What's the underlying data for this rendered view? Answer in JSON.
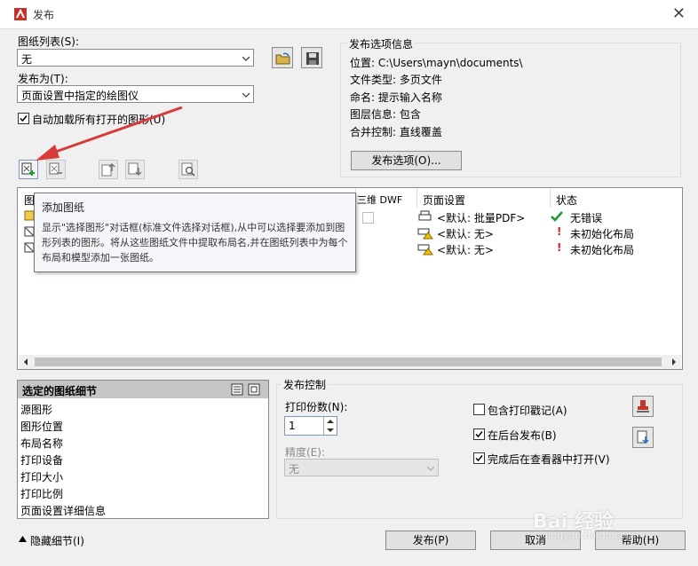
{
  "window": {
    "title": "发布",
    "close": "✕"
  },
  "sheet_list": {
    "label": "图纸列表(S):",
    "value": "无"
  },
  "publish_to": {
    "label": "发布为(T):",
    "value": "页面设置中指定的绘图仪"
  },
  "auto_load": {
    "label": "自动加载所有打开的图形(U)",
    "checked": true
  },
  "options_info": {
    "title": "发布选项信息",
    "rows": [
      "位置: C:\\Users\\mayn\\documents\\",
      "文件类型: 多页文件",
      "命名: 提示输入名称",
      "图层信息: 包含",
      "合并控制: 直线覆盖"
    ],
    "button": "发布选项(O)..."
  },
  "list": {
    "headers": [
      "图",
      "三维 DWF",
      "页面设置",
      "状态"
    ],
    "rows": [
      {
        "page_setup": "<默认: 批量PDF>",
        "status": "无错误",
        "status_icon": "green-check"
      },
      {
        "page_setup": "<默认: 无>",
        "status": "未初始化布局",
        "status_icon": "red-exclamation"
      },
      {
        "page_setup": "<默认: 无>",
        "status": "未初始化布局",
        "status_icon": "red-exclamation"
      }
    ]
  },
  "tooltip": {
    "title": "添加图纸",
    "body": "显示\"选择图形\"对话框(标准文件选择对话框),从中可以选择要添加到图形列表的图形。将从这些图纸文件中提取布局名,并在图纸列表中为每个布局和模型添加一张图纸。"
  },
  "details": {
    "title": "选定的图纸细节",
    "items": [
      "源图形",
      "图形位置",
      "布局名称",
      "打印设备",
      "打印大小",
      "打印比例",
      "页面设置详细信息"
    ]
  },
  "publish_control": {
    "title": "发布控制",
    "copies_label": "打印份数(N):",
    "copies_value": "1",
    "precision_label": "精度(E):",
    "precision_value": "无",
    "include_stamp": {
      "label": "包含打印戳记(A)",
      "checked": false
    },
    "background": {
      "label": "在后台发布(B)",
      "checked": true
    },
    "open_viewer": {
      "label": "完成后在查看器中打开(V)",
      "checked": true
    }
  },
  "footer": {
    "hide_details": "隐藏细节(I)",
    "publish": "发布(P)",
    "cancel": "取消",
    "help": "帮助(H)"
  },
  "watermark": {
    "brand": "Bai 经验",
    "url": "jingyan.baidu.com"
  },
  "colors": {
    "accent": "#d83a3a",
    "ok": "#1a9a2a",
    "warn": "#e02020"
  }
}
